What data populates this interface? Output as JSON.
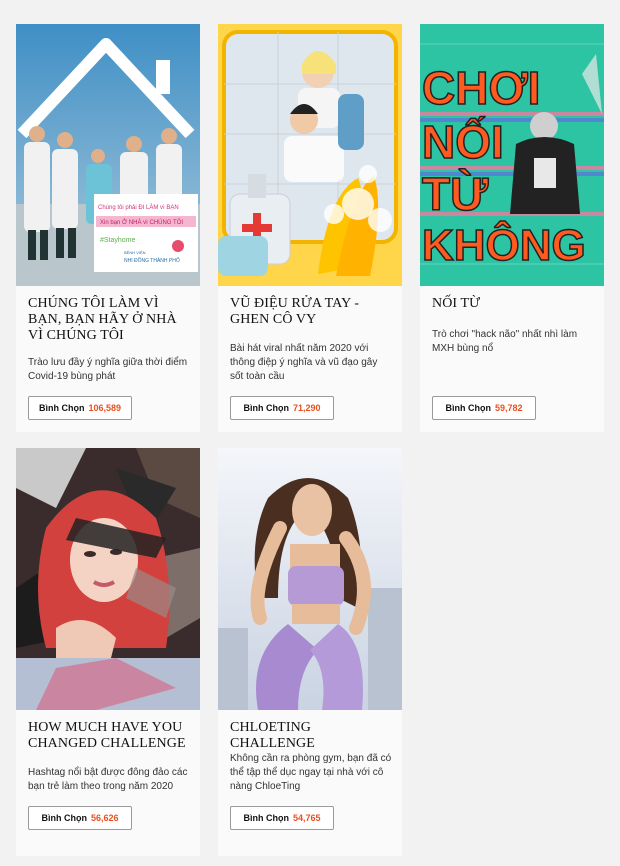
{
  "cards": [
    {
      "title": "CHÚNG TÔI LÀM VÌ BẠN, BẠN HÃY Ở NHÀ VÌ CHÚNG TÔI",
      "desc": "Trào lưu đầy ý nghĩa giữa thời điểm Covid-19 bùng phát",
      "vote_label": "Bình Chọn",
      "votes": "106,589",
      "sign": [
        "Chúng tôi phải ĐI LÀM vì BẠN",
        "Xin bạn Ở NHÀ vì CHÚNG TÔI",
        "#Stayhome",
        "BỆNH VIỆN",
        "NHI ĐỒNG THÀNH PHỐ"
      ]
    },
    {
      "title": "VŨ ĐIỆU RỬA TAY - GHEN CÔ VY",
      "desc": "Bài hát viral nhất năm 2020 với thông điệp ý nghĩa và vũ đạo gây sốt toàn cầu",
      "vote_label": "Bình Chọn",
      "votes": "71,290"
    },
    {
      "title": "NỐI TỪ",
      "desc": "Trò chơi \"hack não\" nhất nhì làm MXH bùng nổ",
      "vote_label": "Bình Chọn",
      "votes": "59,782",
      "poster_lines": [
        "CHƠI",
        "NỐI",
        "TỪ",
        "KHÔNG"
      ]
    },
    {
      "title": "HOW MUCH HAVE YOU CHANGED CHALLENGE",
      "desc": "Hashtag nổi bật được đông đảo các bạn trẻ làm theo trong năm 2020",
      "vote_label": "Bình Chọn",
      "votes": "56,626"
    },
    {
      "title": "CHLOETING CHALLENGE",
      "desc": "Không cần ra phòng gym, bạn đã có thể tập thể dục ngay tại nhà với cô nàng ChloeTing",
      "vote_label": "Bình Chọn",
      "votes": "54,765"
    }
  ]
}
